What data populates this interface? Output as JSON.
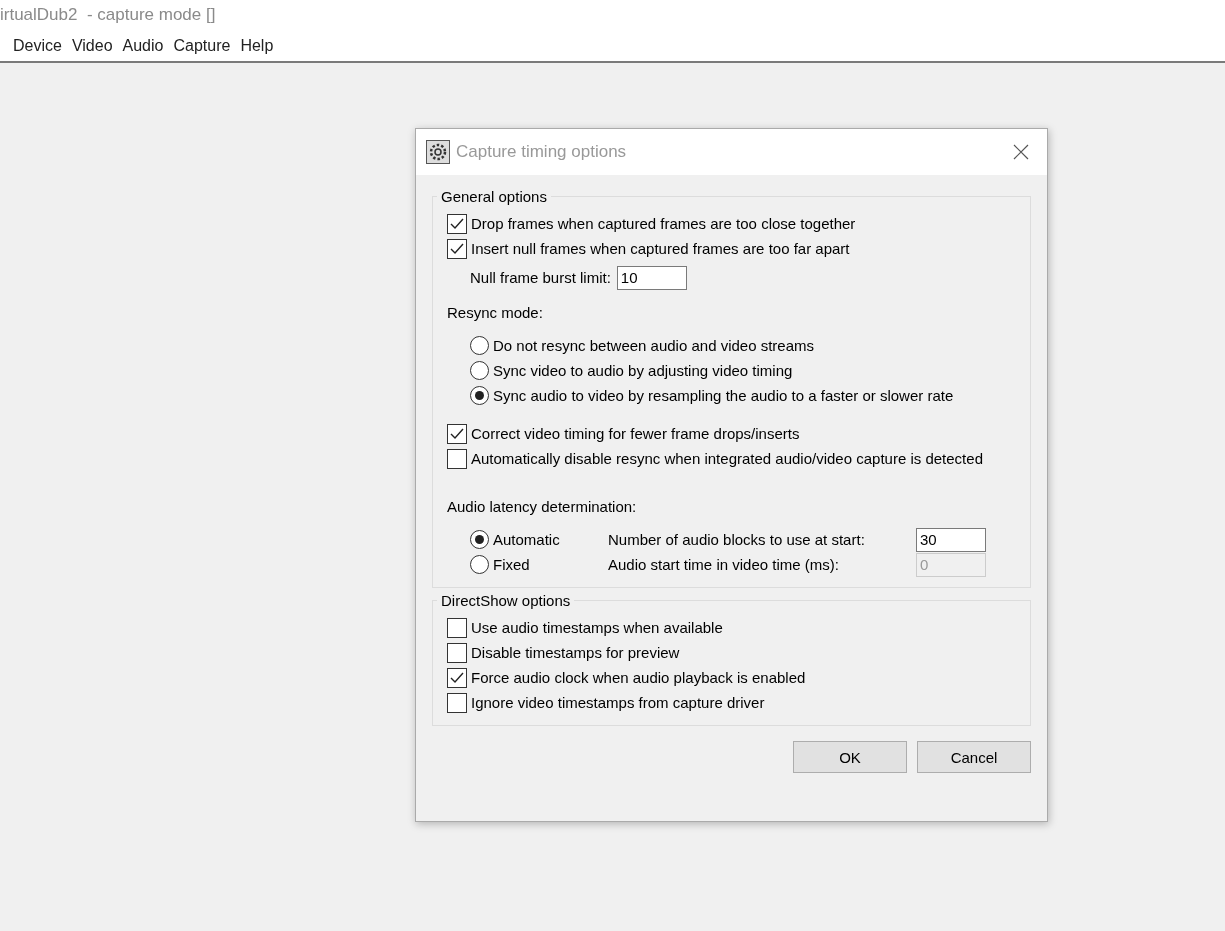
{
  "window": {
    "title": "irtualDub2  - capture mode []"
  },
  "menu": [
    "Device",
    "Video",
    "Audio",
    "Capture",
    "Help"
  ],
  "dialog": {
    "title": "Capture timing options",
    "general_options": {
      "label": "General options",
      "checkboxes": [
        {
          "label": "Drop frames when captured frames are too close together",
          "checked": true
        },
        {
          "label": "Insert null frames when captured frames are too far apart",
          "checked": true
        }
      ],
      "burst_limit": {
        "label": "Null frame burst limit:",
        "value": "10"
      },
      "resync_mode": {
        "label": "Resync mode:",
        "options": [
          {
            "label": "Do not resync between audio and video streams",
            "selected": false
          },
          {
            "label": "Sync video to audio by adjusting video timing",
            "selected": false
          },
          {
            "label": "Sync audio to video by resampling the audio to a faster or slower rate",
            "selected": true
          }
        ]
      },
      "resync_checkboxes": [
        {
          "label": "Correct video timing for fewer frame drops/inserts",
          "checked": true
        },
        {
          "label": "Automatically disable resync when integrated audio/video capture is detected",
          "checked": false
        }
      ],
      "audio_latency": {
        "label": "Audio latency determination:",
        "options": [
          {
            "label": "Automatic",
            "selected": true
          },
          {
            "label": "Fixed",
            "selected": false
          }
        ],
        "fields": [
          {
            "label": "Number of audio blocks to use at start:",
            "value": "30",
            "disabled": false
          },
          {
            "label": "Audio start time in video time (ms):",
            "value": "0",
            "disabled": true
          }
        ]
      }
    },
    "directshow_options": {
      "label": "DirectShow options",
      "checkboxes": [
        {
          "label": "Use audio timestamps when available",
          "checked": false
        },
        {
          "label": "Disable timestamps for preview",
          "checked": false
        },
        {
          "label": "Force audio clock when audio playback is enabled",
          "checked": true
        },
        {
          "label": "Ignore video timestamps from capture driver",
          "checked": false
        }
      ]
    },
    "buttons": [
      "OK",
      "Cancel"
    ]
  }
}
